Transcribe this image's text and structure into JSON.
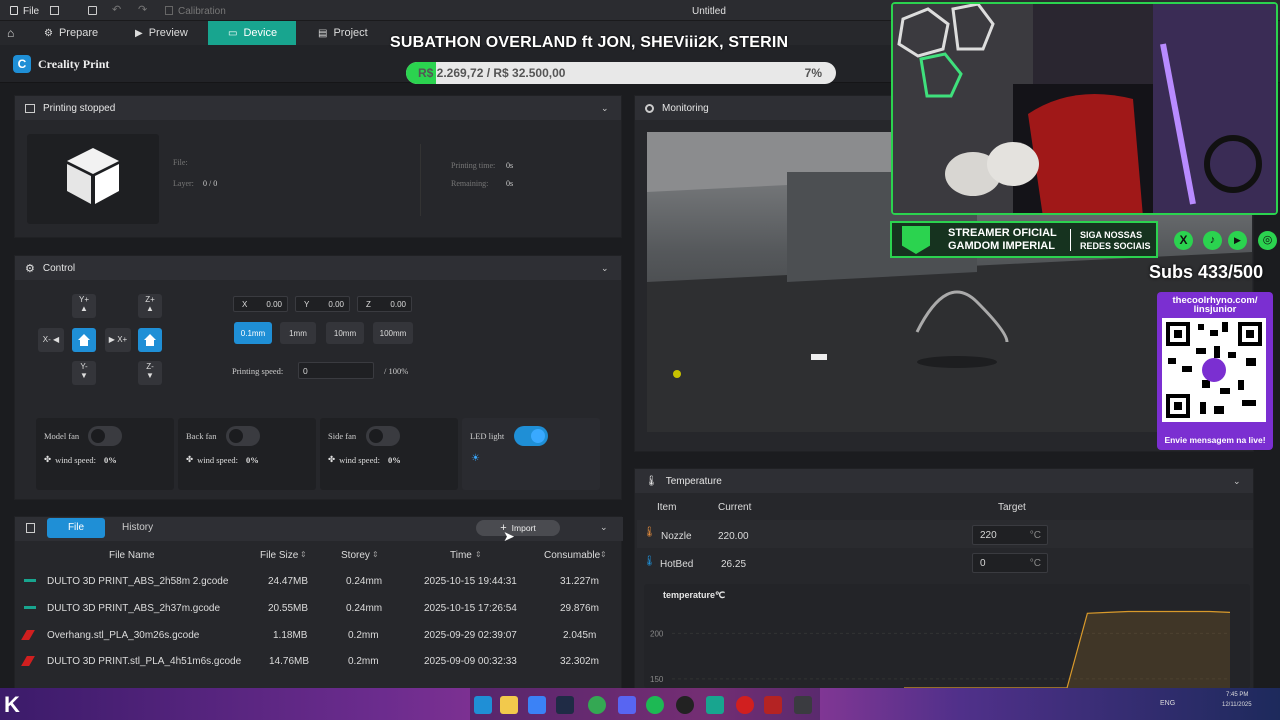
{
  "titlebar": {
    "file_label": "File",
    "calibration_label": "Calibration",
    "window_title": "Untitled"
  },
  "nav": {
    "tabs": [
      {
        "label": "Prepare"
      },
      {
        "label": "Preview"
      },
      {
        "label": "Device",
        "active": true
      },
      {
        "label": "Project"
      }
    ]
  },
  "brand": {
    "name": "Creality Print"
  },
  "overlay": {
    "stream_title": "SUBATHON OVERLAND ft JON, SHEViii2K, STERIN",
    "goal_text": "R$ 2.269,72 / R$ 32.500,00",
    "goal_percent_label": "7%",
    "goal_fraction": 0.07,
    "sponsor_line1": "STREAMER OFICIAL",
    "sponsor_line2": "GAMDOM IMPERIAL",
    "follow_line1": "SIGA NOSSAS",
    "follow_line2": "REDES SOCIAIS",
    "subs": "Subs 433/500",
    "qr_url_line1": "thecoolrhyno.com/",
    "qr_url_line2": "linsjunior",
    "qr_caption": "Envie mensagem na live!"
  },
  "status": {
    "header": "Printing stopped",
    "file_label": "File:",
    "layer_label": "Layer:",
    "layer_value": "0 / 0",
    "printing_time_label": "Printing time:",
    "printing_time_value": "0s",
    "remaining_label": "Remaining:",
    "remaining_value": "0s"
  },
  "monitoring": {
    "header": "Monitoring"
  },
  "control": {
    "header": "Control",
    "y_plus": "Y+",
    "y_minus": "Y-",
    "x_minus": "X-",
    "x_plus": "X+",
    "z_plus": "Z+",
    "z_minus": "Z-",
    "x_label": "X",
    "x_value": "0.00",
    "y_label": "Y",
    "y_value": "0.00",
    "z_label": "Z",
    "z_value": "0.00",
    "steps": [
      "0.1mm",
      "1mm",
      "10mm",
      "100mm"
    ],
    "speed_label": "Printing speed:",
    "speed_value": "0",
    "speed_max": "/ 100%",
    "fans": [
      {
        "label": "Model fan",
        "ws_label": "wind speed:",
        "ws_value": "0%"
      },
      {
        "label": "Back fan",
        "ws_label": "wind speed:",
        "ws_value": "0%"
      },
      {
        "label": "Side fan",
        "ws_label": "wind speed:",
        "ws_value": "0%"
      }
    ],
    "led_label": "LED light"
  },
  "files": {
    "tab_file": "File",
    "tab_history": "History",
    "import_label": "Import",
    "columns": [
      "File Name",
      "File Size",
      "Storey",
      "Time",
      "Consumable"
    ],
    "rows": [
      {
        "name": "DULTO 3D PRINT_ABS_2h58m 2.gcode",
        "size": "24.47MB",
        "storey": "0.24mm",
        "time": "2025-10-15 19:44:31",
        "consumable": "31.227m"
      },
      {
        "name": "DULTO 3D PRINT_ABS_2h37m.gcode",
        "size": "20.55MB",
        "storey": "0.24mm",
        "time": "2025-10-15 17:26:54",
        "consumable": "29.876m"
      },
      {
        "name": "Overhang.stl_PLA_30m26s.gcode",
        "size": "1.18MB",
        "storey": "0.2mm",
        "time": "2025-09-29 02:39:07",
        "consumable": "2.045m"
      },
      {
        "name": "DULTO 3D PRINT.stl_PLA_4h51m6s.gcode",
        "size": "14.76MB",
        "storey": "0.2mm",
        "time": "2025-09-09 00:32:33",
        "consumable": "32.302m"
      }
    ]
  },
  "temperature": {
    "header": "Temperature",
    "col_item": "Item",
    "col_current": "Current",
    "col_target": "Target",
    "rows": [
      {
        "item": "Nozzle",
        "current": "220.00",
        "target": "220",
        "unit": "°C"
      },
      {
        "item": "HotBed",
        "current": "26.25",
        "target": "0",
        "unit": "°C"
      }
    ],
    "chart_title": "temperature℃"
  },
  "chart_data": {
    "type": "line",
    "title": "temperature℃",
    "yticks": [
      200,
      150
    ],
    "ylim": [
      140,
      230
    ],
    "series": [
      {
        "values": [
          140,
          140,
          140,
          140,
          140,
          140,
          140,
          140,
          140,
          222,
          223,
          224,
          224,
          224,
          224,
          224,
          223
        ]
      }
    ]
  },
  "taskbar": {
    "lang": "ENG",
    "time": "7:45 PM",
    "date": "12/11/2025"
  },
  "colors": {
    "accent": "#18a58f",
    "blue": "#1f8fd6",
    "green_overlay": "#2bd34f"
  }
}
